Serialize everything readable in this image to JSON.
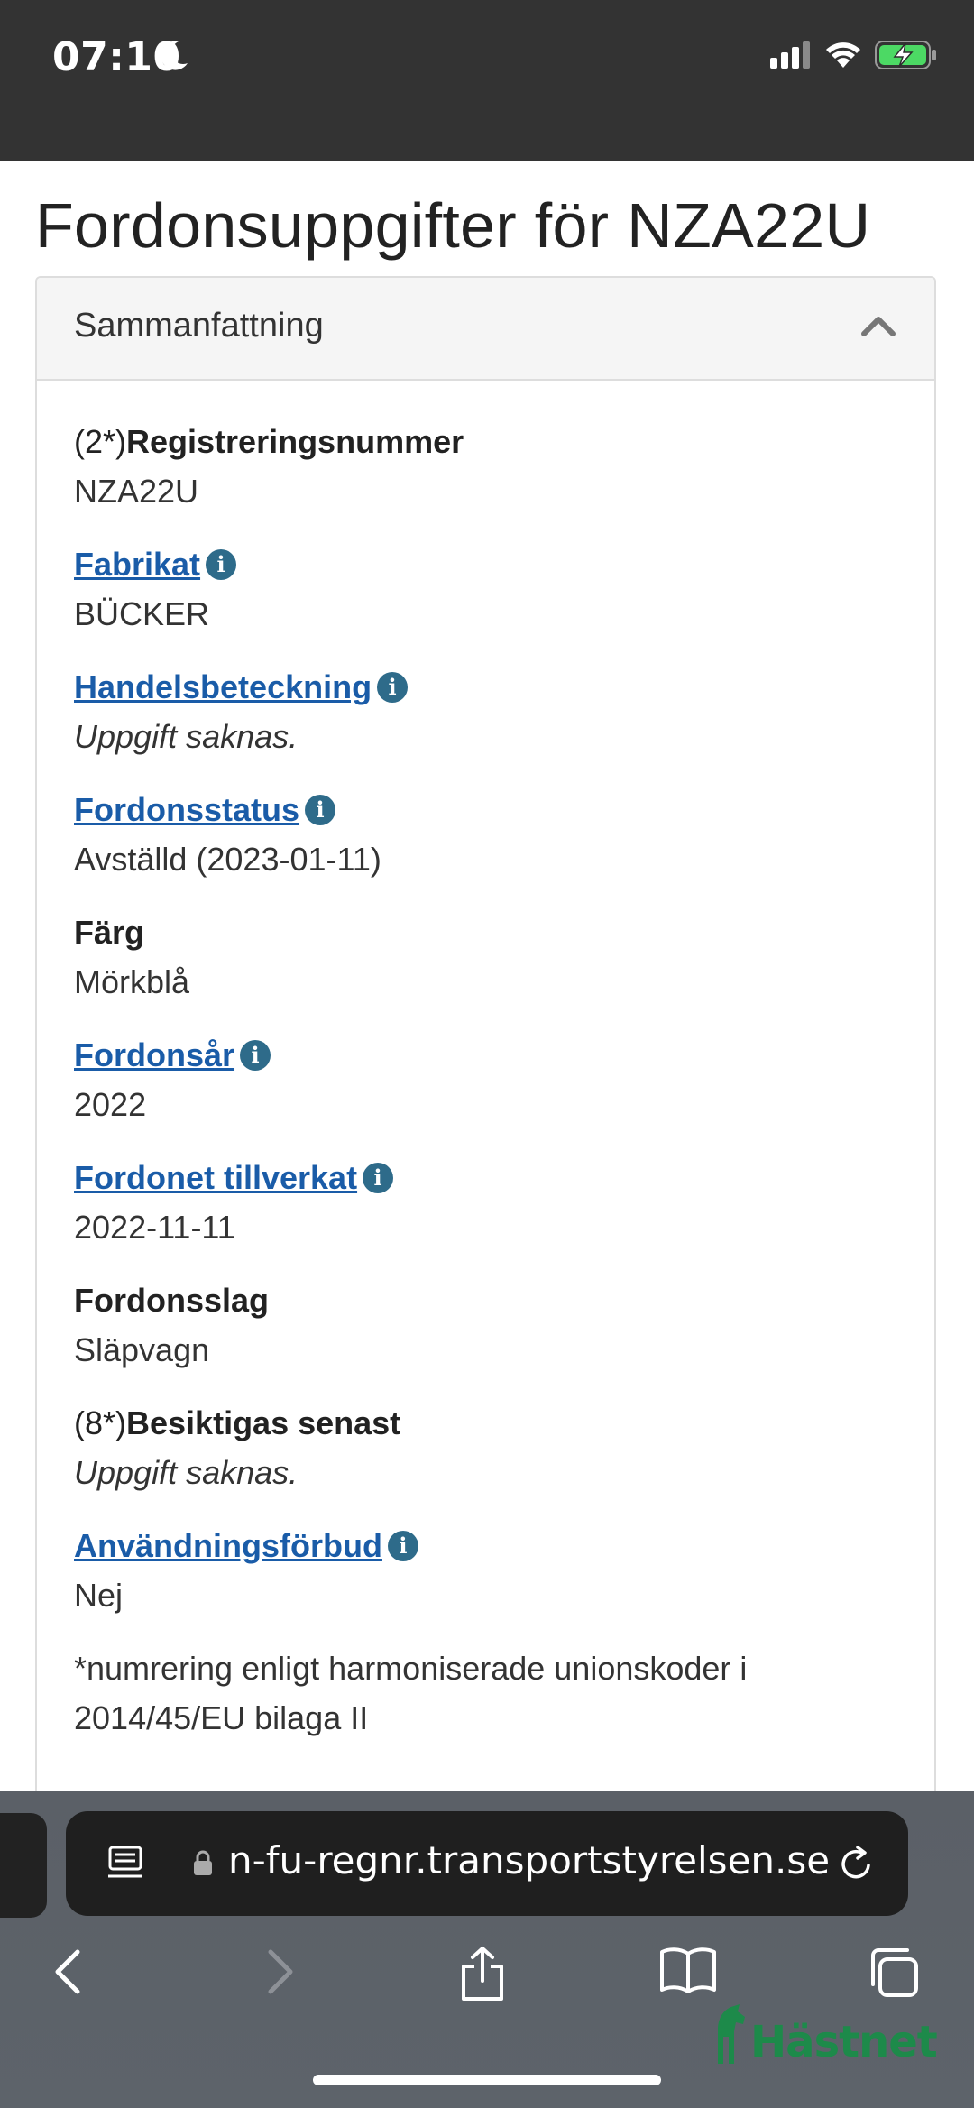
{
  "status_bar": {
    "time": "07:10"
  },
  "page": {
    "title": "Fordonsuppgifter för NZA22U",
    "panel_heading": "Sammanfattning",
    "fields": [
      {
        "prefix": "(2*)",
        "label": "Registreringsnummer",
        "value": "NZA22U"
      },
      {
        "label": "Fabrikat",
        "value": "BÜCKER"
      },
      {
        "label": "Handelsbeteckning",
        "value": "Uppgift saknas."
      },
      {
        "label": "Fordonsstatus",
        "value": "Avställd (2023-01-11)"
      },
      {
        "label": "Färg",
        "value": "Mörkblå"
      },
      {
        "label": "Fordonsår",
        "value": "2022"
      },
      {
        "label": "Fordonet tillverkat",
        "value": "2022-11-11"
      },
      {
        "label": "Fordonsslag",
        "value": "Släpvagn"
      },
      {
        "prefix": "(8*)",
        "label": "Besiktigas senast",
        "value": "Uppgift saknas."
      },
      {
        "label": "Användningsförbud",
        "value": "Nej"
      }
    ],
    "footnote": "*numrering enligt harmoniserade unionskoder i 2014/45/EU bilaga II"
  },
  "browser": {
    "url": "n-fu-regnr.transportstyrelsen.se",
    "watermark": "Hästnet"
  },
  "colors": {
    "link": "#1a5ca8",
    "info_icon": "#2e6b8a",
    "status_bar": "#333333",
    "watermark": "#1d8a4a"
  }
}
